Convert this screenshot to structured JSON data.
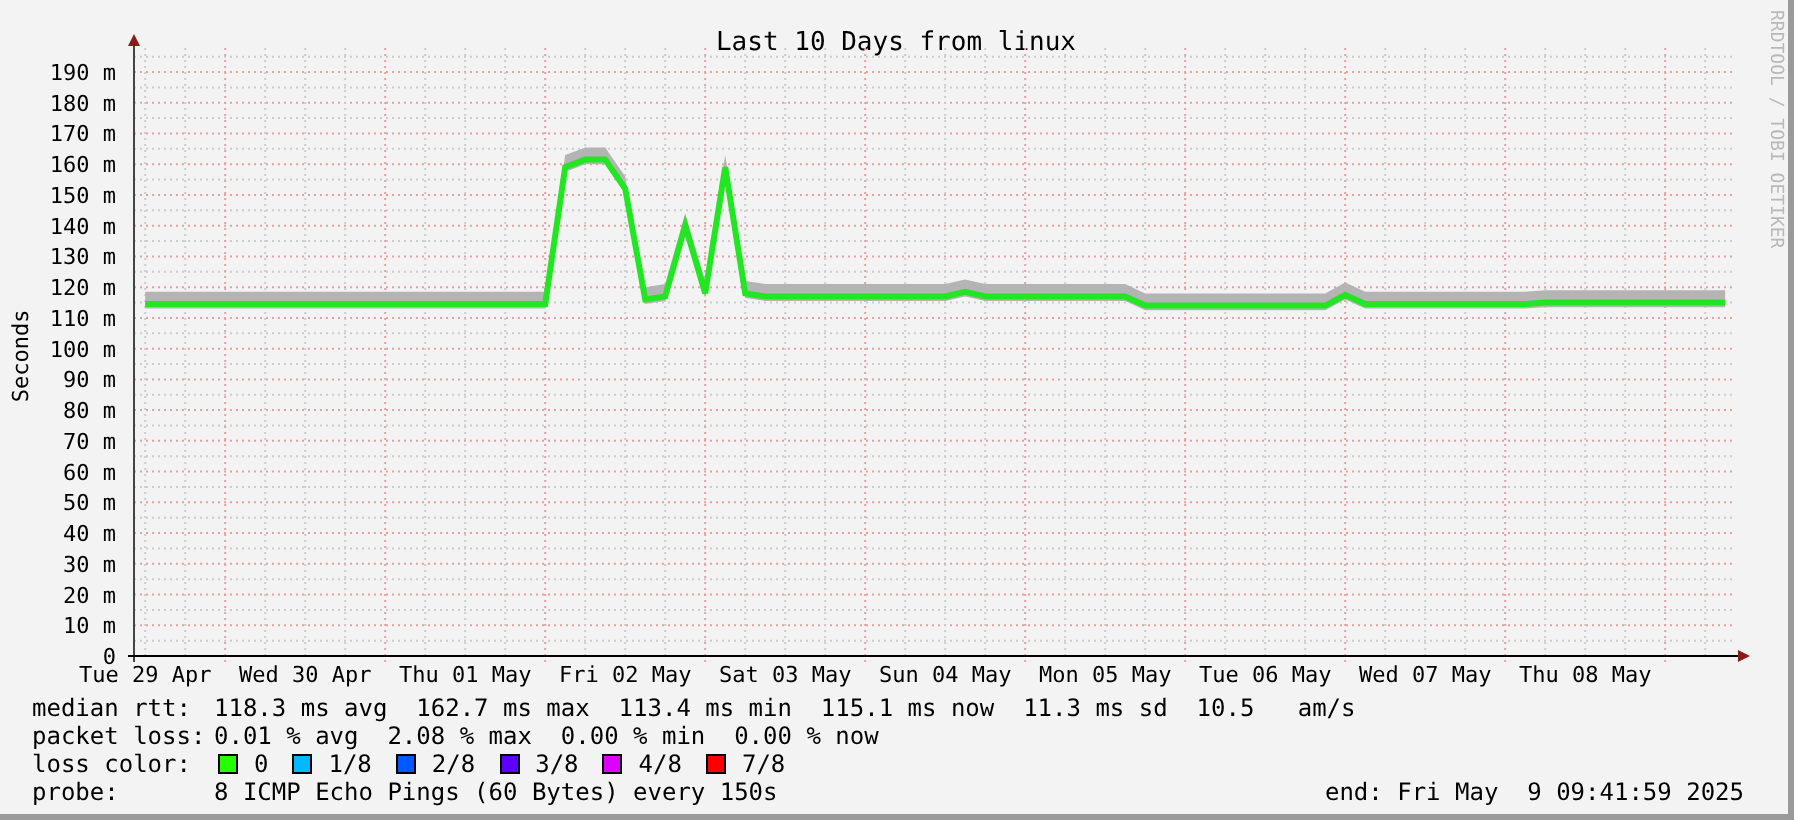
{
  "credit": "RRDTOOL / TOBI OETIKER",
  "chart_data": {
    "type": "line",
    "title": "Last 10 Days from linux",
    "ylabel": "Seconds",
    "grid": true,
    "ylim": [
      0,
      190
    ],
    "categories": [
      "Tue 29 Apr",
      null,
      null,
      null,
      null,
      null,
      null,
      null,
      "Wed 30 Apr",
      null,
      null,
      null,
      null,
      null,
      null,
      null,
      "Thu 01 May",
      null,
      null,
      null,
      null,
      null,
      null,
      null,
      "Fri 02 May",
      null,
      null,
      null,
      null,
      null,
      null,
      null,
      "Sat 03 May",
      null,
      null,
      null,
      null,
      null,
      null,
      null,
      "Sun 04 May",
      null,
      null,
      null,
      null,
      null,
      null,
      null,
      "Mon 05 May",
      null,
      null,
      null,
      null,
      null,
      null,
      null,
      "Tue 06 May",
      null,
      null,
      null,
      null,
      null,
      null,
      null,
      "Wed 07 May",
      null,
      null,
      null,
      null,
      null,
      null,
      null,
      "Thu 08 May",
      null,
      null,
      null,
      null,
      null,
      null,
      null
    ],
    "yticks": [
      {
        "value": 0,
        "label": "0"
      },
      {
        "value": 10,
        "label": "10 m"
      },
      {
        "value": 20,
        "label": "20 m"
      },
      {
        "value": 30,
        "label": "30 m"
      },
      {
        "value": 40,
        "label": "40 m"
      },
      {
        "value": 50,
        "label": "50 m"
      },
      {
        "value": 60,
        "label": "60 m"
      },
      {
        "value": 70,
        "label": "70 m"
      },
      {
        "value": 80,
        "label": "80 m"
      },
      {
        "value": 90,
        "label": "90 m"
      },
      {
        "value": 100,
        "label": "100 m"
      },
      {
        "value": 110,
        "label": "110 m"
      },
      {
        "value": 120,
        "label": "120 m"
      },
      {
        "value": 130,
        "label": "130 m"
      },
      {
        "value": 140,
        "label": "140 m"
      },
      {
        "value": 150,
        "label": "150 m"
      },
      {
        "value": 160,
        "label": "160 m"
      },
      {
        "value": 170,
        "label": "170 m"
      },
      {
        "value": 180,
        "label": "180 m"
      },
      {
        "value": 190,
        "label": "190 m"
      }
    ],
    "series": [
      {
        "color": "#22e622",
        "values": [
          114.5,
          114.5,
          114.5,
          114.5,
          114.5,
          114.5,
          114.5,
          114.5,
          114.5,
          114.5,
          114.5,
          114.5,
          114.5,
          114.5,
          114.5,
          114.5,
          114.5,
          114.5,
          114.5,
          114.5,
          114.5,
          159,
          161.5,
          161.5,
          152,
          116,
          117,
          140,
          118,
          159,
          118,
          117,
          117,
          117,
          117,
          117,
          117,
          117,
          117,
          117,
          117,
          118.5,
          117,
          117,
          117,
          117,
          117,
          117,
          117,
          117,
          114,
          114,
          114,
          114,
          114,
          114,
          114,
          114,
          114,
          114,
          117.5,
          114.5,
          114.5,
          114.5,
          114.5,
          114.5,
          114.5,
          114.5,
          114.5,
          114.5,
          115,
          115,
          115,
          115,
          115,
          115,
          115,
          115,
          115,
          115
        ]
      }
    ]
  },
  "legend": [
    {
      "kind": "text",
      "label": "median rtt:",
      "value": "118.3 ms avg  162.7 ms max  113.4 ms min  115.1 ms now  11.3 ms sd  10.5   am/s"
    },
    {
      "kind": "text",
      "label": "packet loss:",
      "value": "0.01 % avg  2.08 % max  0.00 % min  0.00 % now"
    },
    {
      "kind": "colors",
      "label": "loss color:",
      "items": [
        {
          "label": "0",
          "color": "#26ff00"
        },
        {
          "label": "1/8",
          "color": "#00b8ff"
        },
        {
          "label": "2/8",
          "color": "#0059ff"
        },
        {
          "label": "3/8",
          "color": "#5e00ff"
        },
        {
          "label": "4/8",
          "color": "#dd00ff"
        },
        {
          "label": "7/8",
          "color": "#ff0000"
        }
      ]
    },
    {
      "kind": "probe",
      "label": "probe:",
      "value": "8 ICMP Echo Pings (60 Bytes) every 150s",
      "end": "end: Fri May  9 09:41:59 2025"
    }
  ]
}
